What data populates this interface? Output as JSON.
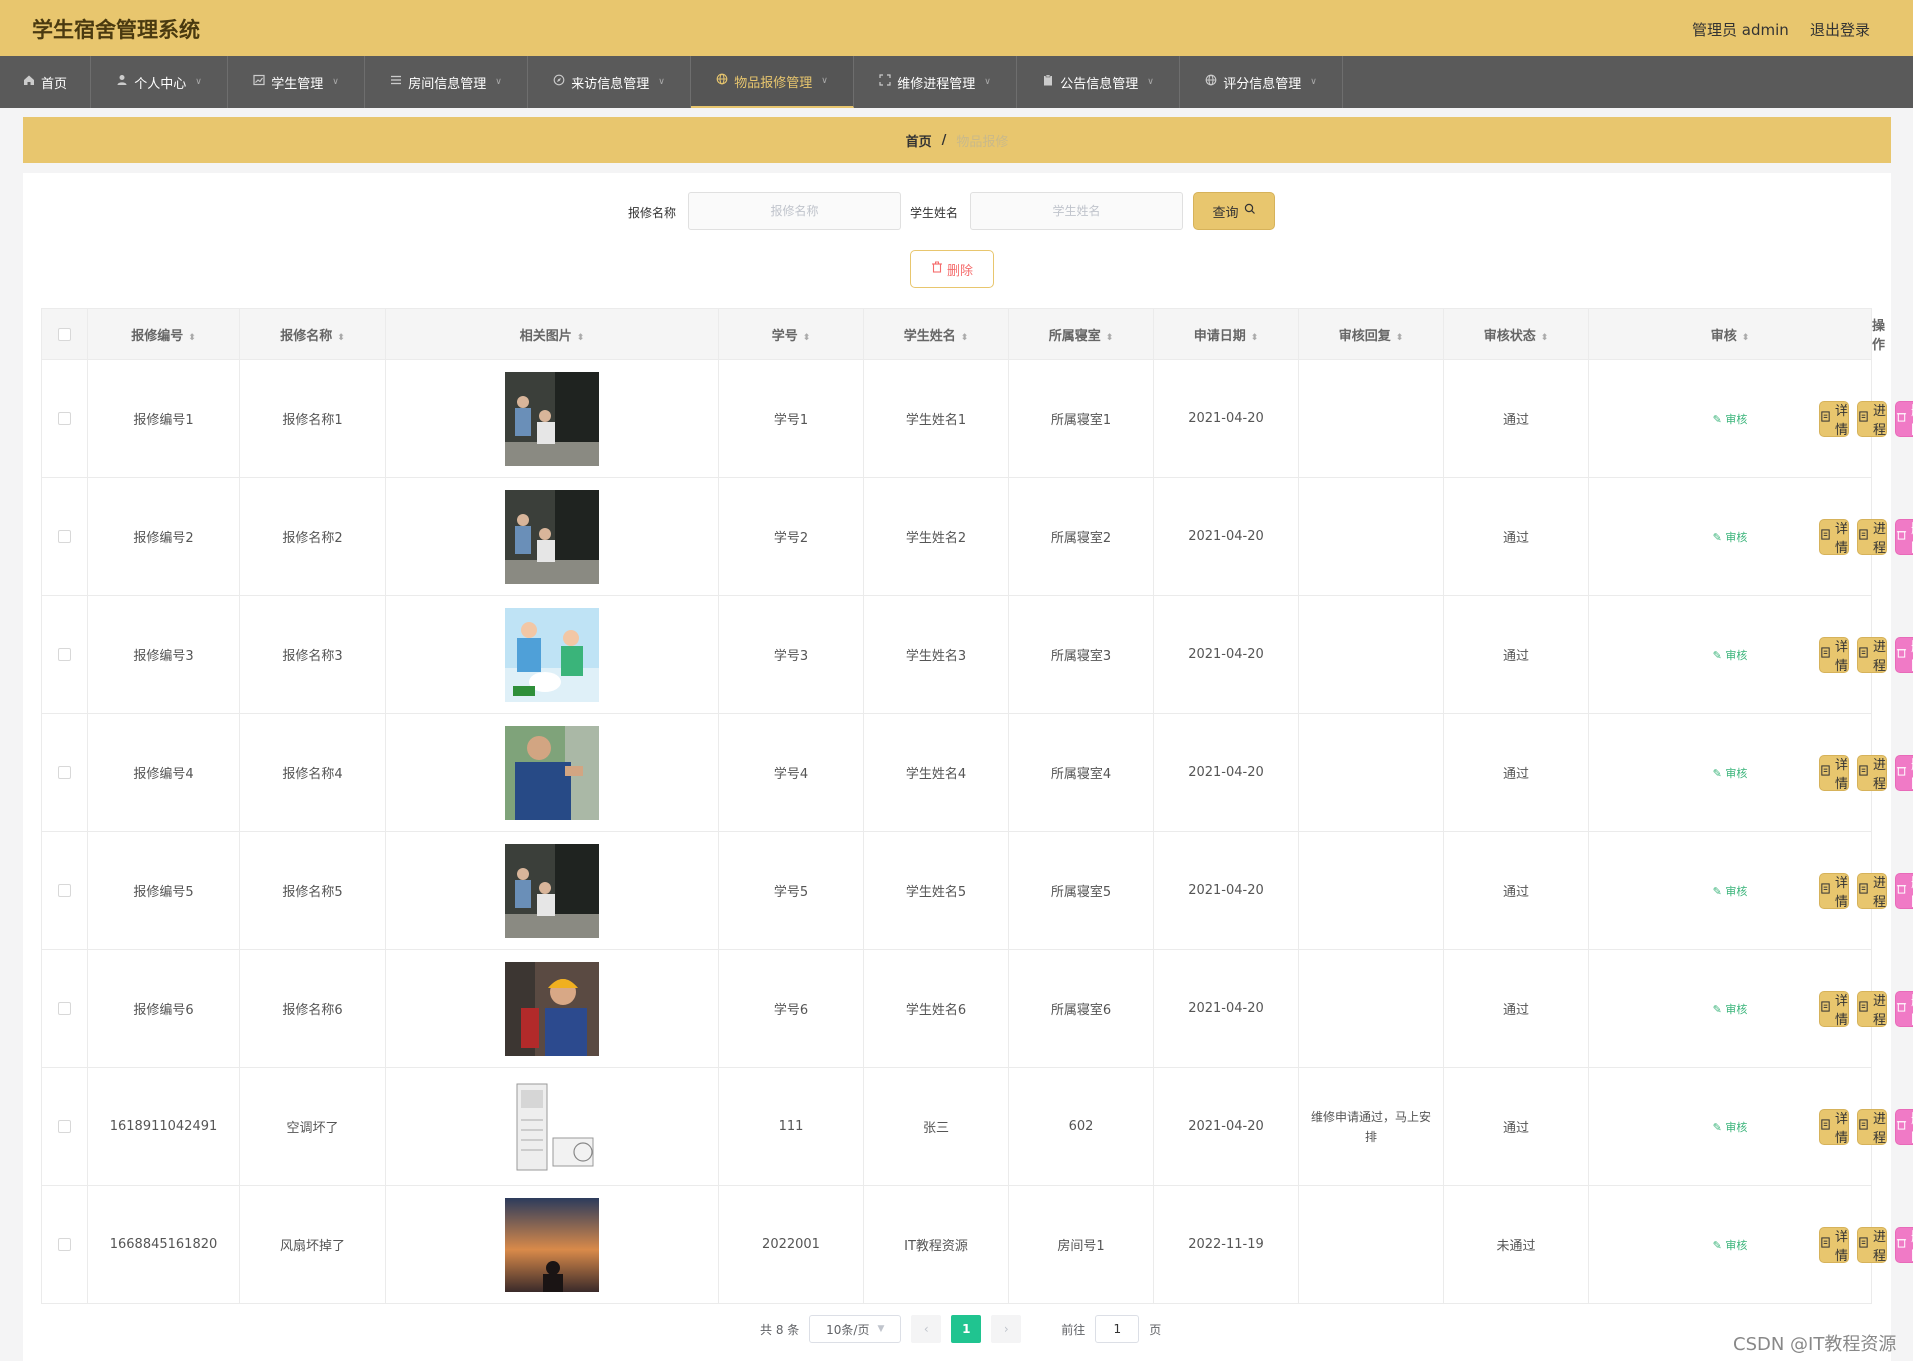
{
  "header": {
    "title": "学生宿舍管理系统",
    "admin": "管理员 admin",
    "logout": "退出登录"
  },
  "nav": [
    {
      "label": "首页",
      "icon": "home-icon",
      "active": false,
      "caret": false
    },
    {
      "label": "个人中心",
      "icon": "user-icon",
      "active": false,
      "caret": true
    },
    {
      "label": "学生管理",
      "icon": "chart-icon",
      "active": false,
      "caret": true
    },
    {
      "label": "房间信息管理",
      "icon": "list-icon",
      "active": false,
      "caret": true
    },
    {
      "label": "来访信息管理",
      "icon": "compass-icon",
      "active": false,
      "caret": true
    },
    {
      "label": "物品报修管理",
      "icon": "globe-icon",
      "active": true,
      "caret": true
    },
    {
      "label": "维修进程管理",
      "icon": "expand-icon",
      "active": false,
      "caret": true
    },
    {
      "label": "公告信息管理",
      "icon": "clipboard-icon",
      "active": false,
      "caret": true
    },
    {
      "label": "评分信息管理",
      "icon": "globe-icon",
      "active": false,
      "caret": true
    }
  ],
  "breadcrumb": {
    "home": "首页",
    "sep": "/",
    "current": "物品报修"
  },
  "search": {
    "name_label": "报修名称",
    "name_placeholder": "报修名称",
    "student_label": "学生姓名",
    "student_placeholder": "学生姓名",
    "query": "查询"
  },
  "batch_delete": "删除",
  "table": {
    "headers": [
      "报修编号",
      "报修名称",
      "相关图片",
      "学号",
      "学生姓名",
      "所属寝室",
      "申请日期",
      "审核回复",
      "审核状态",
      "审核",
      "操作"
    ],
    "audit_label": "审核",
    "detail_label": "详情",
    "progress_label": "进程",
    "delete_label": "删除",
    "rows": [
      {
        "id": "报修编号1",
        "name": "报修名称1",
        "image": "repair-worker-photo",
        "student_no": "学号1",
        "student_name": "学生姓名1",
        "dorm": "所属寝室1",
        "date": "2021-04-20",
        "reply": "",
        "status": "通过"
      },
      {
        "id": "报修编号2",
        "name": "报修名称2",
        "image": "repair-worker-photo",
        "student_no": "学号2",
        "student_name": "学生姓名2",
        "dorm": "所属寝室2",
        "date": "2021-04-20",
        "reply": "",
        "status": "通过"
      },
      {
        "id": "报修编号3",
        "name": "报修名称3",
        "image": "plumber-illustration",
        "student_no": "学号3",
        "student_name": "学生姓名3",
        "dorm": "所属寝室3",
        "date": "2021-04-20",
        "reply": "",
        "status": "通过"
      },
      {
        "id": "报修编号4",
        "name": "报修名称4",
        "image": "electrician-photo",
        "student_no": "学号4",
        "student_name": "学生姓名4",
        "dorm": "所属寝室4",
        "date": "2021-04-20",
        "reply": "",
        "status": "通过"
      },
      {
        "id": "报修编号5",
        "name": "报修名称5",
        "image": "repair-worker-photo",
        "student_no": "学号5",
        "student_name": "学生姓名5",
        "dorm": "所属寝室5",
        "date": "2021-04-20",
        "reply": "",
        "status": "通过"
      },
      {
        "id": "报修编号6",
        "name": "报修名称6",
        "image": "hardhat-worker-photo",
        "student_no": "学号6",
        "student_name": "学生姓名6",
        "dorm": "所属寝室6",
        "date": "2021-04-20",
        "reply": "",
        "status": "通过"
      },
      {
        "id": "1618911042491",
        "name": "空调坏了",
        "image": "air-conditioner-photo",
        "student_no": "111",
        "student_name": "张三",
        "dorm": "602",
        "date": "2021-04-20",
        "reply": "维修申请通过，马上安排",
        "status": "通过"
      },
      {
        "id": "1668845161820",
        "name": "风扇坏掉了",
        "image": "sunset-silhouette-photo",
        "student_no": "2022001",
        "student_name": "IT教程资源",
        "dorm": "房间号1",
        "date": "2022-11-19",
        "reply": "",
        "status": "未通过"
      }
    ]
  },
  "pagination": {
    "total": "共 8 条",
    "page_size": "10条/页",
    "current_page": "1",
    "goto_label": "前往",
    "goto_value": "1",
    "page_unit": "页"
  },
  "watermark": "CSDN @IT教程资源",
  "colors": {
    "accent": "#e8c66e",
    "nav": "#5a5a5a",
    "delete": "#f07ac6",
    "page_active": "#20c490",
    "audit": "#3ab47a"
  }
}
